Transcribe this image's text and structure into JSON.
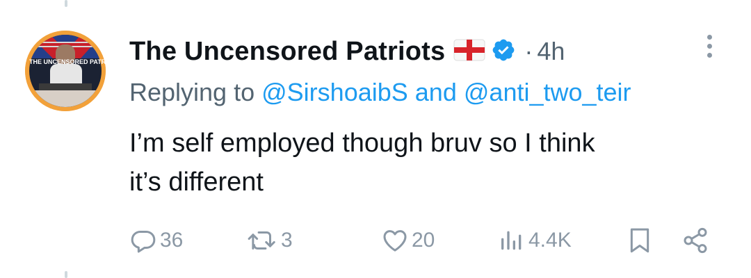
{
  "tweet": {
    "display_name": "The Uncensored Patriots",
    "separator": "·",
    "time": "4h",
    "replying_prefix": "Replying to",
    "mention_1": "@SirshoaibS",
    "and_word": "and",
    "mention_2": "@anti_two_teir",
    "text_line_1": "I’m self employed though bruv so I think",
    "text_line_2": "it’s different",
    "avatar_text": "THE UNCENSORED PATRIOTS"
  },
  "actions": {
    "replies": "36",
    "retweets": "3",
    "likes": "20",
    "views": "4.4K"
  },
  "icons": {
    "flag": "england-flag-icon",
    "verified": "verified-badge-icon",
    "more": "more-options-icon",
    "reply": "reply-icon",
    "retweet": "retweet-icon",
    "like": "heart-icon",
    "views": "views-icon",
    "bookmark": "bookmark-icon",
    "share": "share-icon"
  },
  "colors": {
    "text": "#0f1419",
    "secondary": "#536471",
    "link": "#1d9bf0",
    "icon_gray": "#8b98a5",
    "verified": "#1d9bf0"
  }
}
